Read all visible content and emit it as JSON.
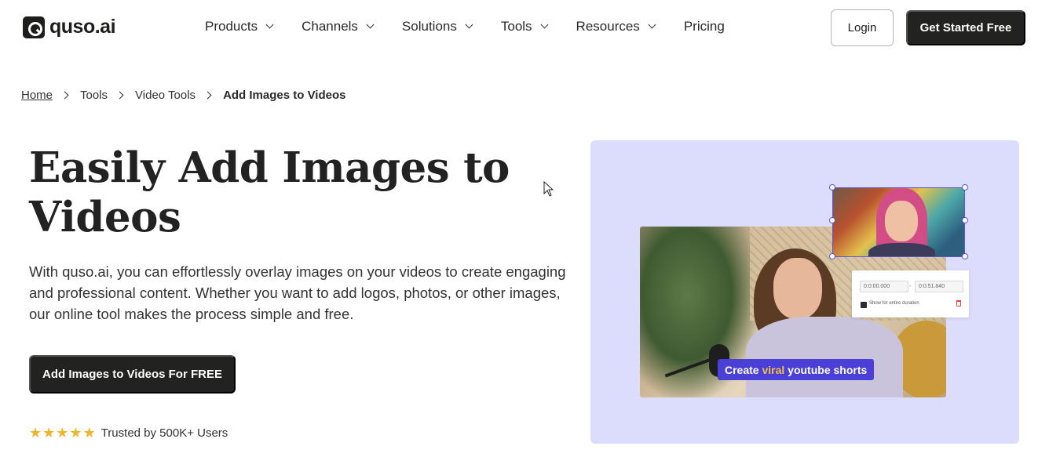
{
  "brand": {
    "name": "quso.ai"
  },
  "nav": {
    "items": [
      {
        "label": "Products",
        "has_dropdown": true
      },
      {
        "label": "Channels",
        "has_dropdown": true
      },
      {
        "label": "Solutions",
        "has_dropdown": true
      },
      {
        "label": "Tools",
        "has_dropdown": true
      },
      {
        "label": "Resources",
        "has_dropdown": true
      },
      {
        "label": "Pricing",
        "has_dropdown": false
      }
    ],
    "login_label": "Login",
    "cta_label": "Get Started Free"
  },
  "breadcrumb": {
    "items": [
      "Home",
      "Tools",
      "Video Tools",
      "Add Images to Videos"
    ]
  },
  "hero": {
    "title": "Easily Add Images to Videos",
    "description": "With quso.ai, you can effortlessly overlay images on your videos to create engaging and professional content. Whether you want to add logos, photos, or other images, our online tool makes the process simple and free.",
    "cta_label": "Add Images to Videos For FREE",
    "rating_stars": 5,
    "rating_text": "Trusted by 500K+ Users"
  },
  "visual": {
    "caption_prefix": "Create ",
    "caption_accent": "viral",
    "caption_suffix": " youtube shorts",
    "start_time": "0:0:00.000",
    "end_time": "0:0:51.840",
    "option_label": "Show for entire duration"
  },
  "colors": {
    "primary_dark": "#222220",
    "visual_bg": "#dcdcfc",
    "caption_bg": "#4a3fd6",
    "caption_accent": "#f5c04a",
    "star": "#f2b42c"
  }
}
